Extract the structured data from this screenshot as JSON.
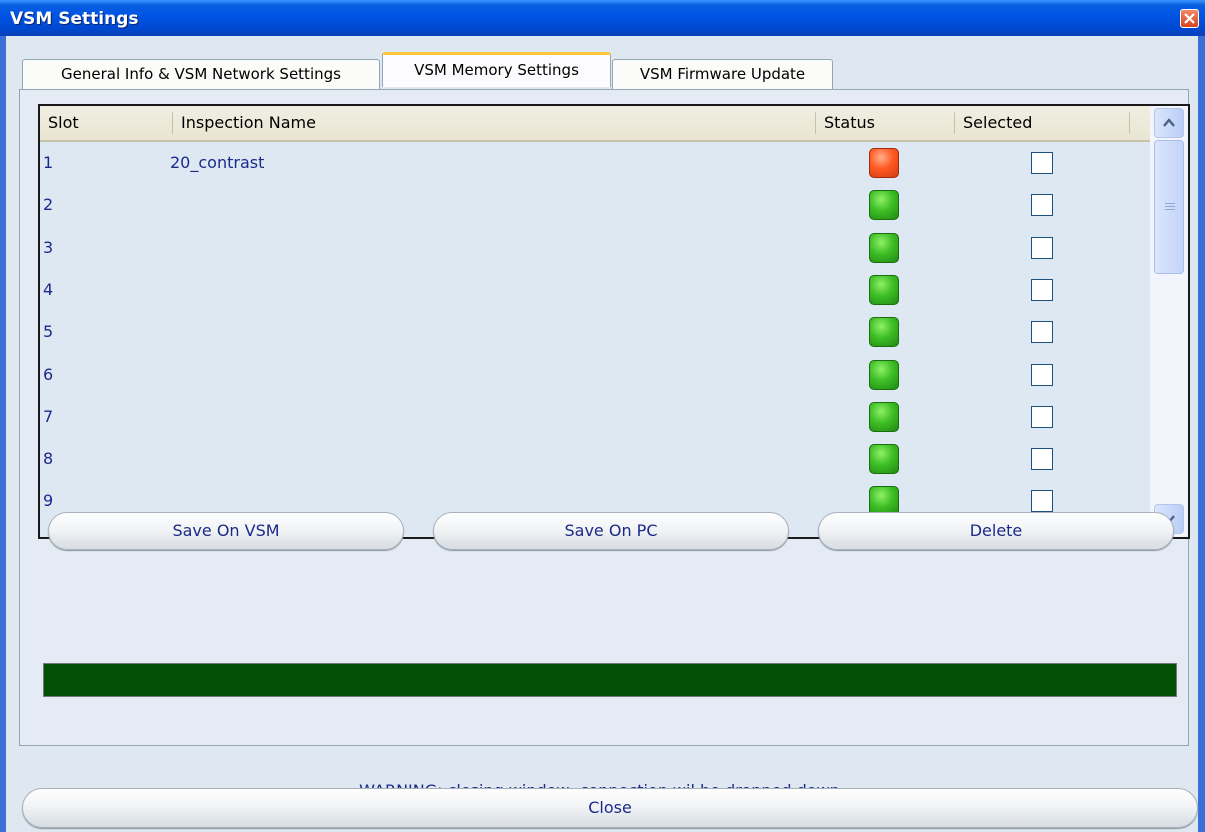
{
  "window": {
    "title": "VSM Settings"
  },
  "tabs": [
    {
      "label": "General Info & VSM Network Settings"
    },
    {
      "label": "VSM Memory Settings"
    },
    {
      "label": "VSM Firmware Update"
    }
  ],
  "active_tab": "VSM Memory Settings",
  "table": {
    "columns": [
      "Slot",
      "Inspection Name",
      "Status",
      "Selected"
    ],
    "rows": [
      {
        "slot": "1",
        "name": "20_contrast",
        "status": "red",
        "selected": false
      },
      {
        "slot": "2",
        "name": "",
        "status": "green",
        "selected": false
      },
      {
        "slot": "3",
        "name": "",
        "status": "green",
        "selected": false
      },
      {
        "slot": "4",
        "name": "",
        "status": "green",
        "selected": false
      },
      {
        "slot": "5",
        "name": "",
        "status": "green",
        "selected": false
      },
      {
        "slot": "6",
        "name": "",
        "status": "green",
        "selected": false
      },
      {
        "slot": "7",
        "name": "",
        "status": "green",
        "selected": false
      },
      {
        "slot": "8",
        "name": "",
        "status": "green",
        "selected": false
      },
      {
        "slot": "9",
        "name": "",
        "status": "green",
        "selected": false
      }
    ]
  },
  "buttons": {
    "save_vsm": "Save On VSM",
    "save_pc": "Save On PC",
    "delete": "Delete",
    "close": "Close"
  },
  "progress": {
    "value": 1.0,
    "color": "#035104"
  },
  "warning": "WARNING: closing window, connection wil be dropped down.",
  "colors": {
    "title_bar": "#0055e5",
    "text_blue": "#1b2a8a",
    "status_green": "#3fbf26",
    "status_red": "#ff5a24"
  }
}
